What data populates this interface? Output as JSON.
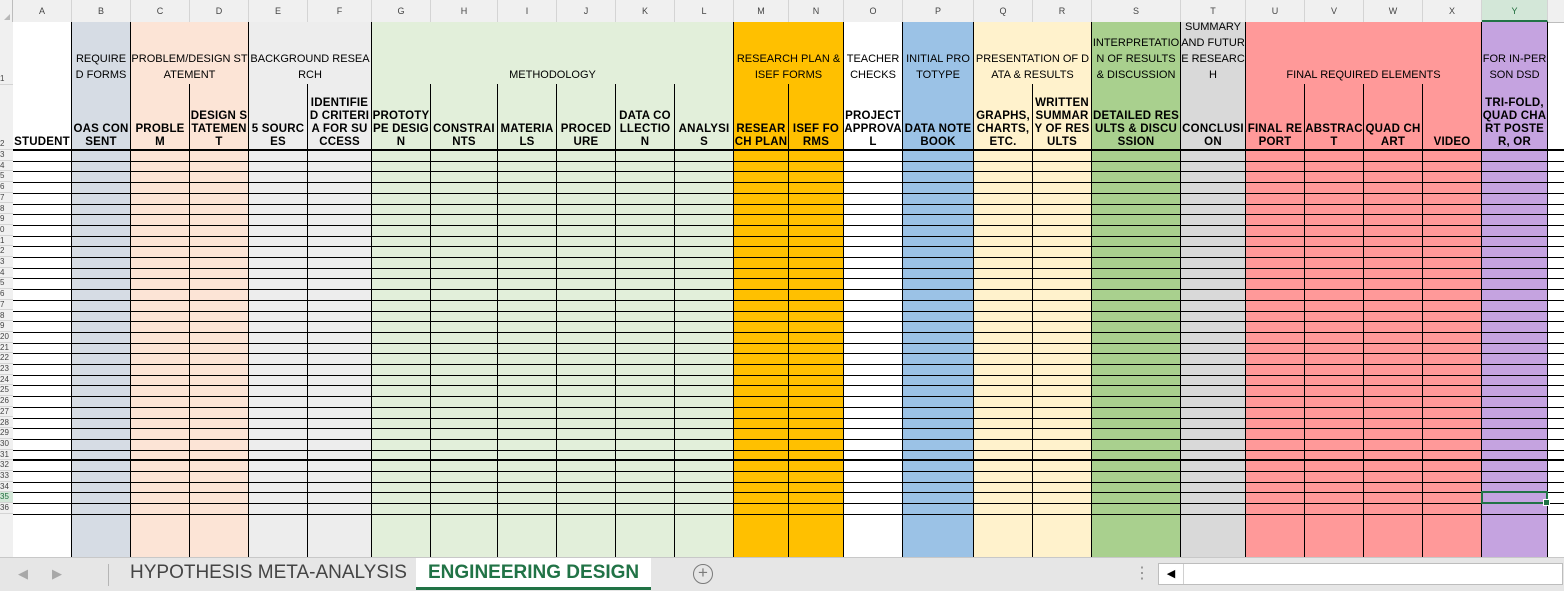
{
  "columns": [
    "A",
    "B",
    "C",
    "D",
    "E",
    "F",
    "G",
    "H",
    "I",
    "J",
    "K",
    "L",
    "M",
    "N",
    "O",
    "P",
    "Q",
    "R",
    "S",
    "T",
    "U",
    "V",
    "W",
    "X",
    "Y"
  ],
  "selected_column": "Y",
  "selected_row": "35",
  "rows": [
    "1",
    "2",
    "3",
    "4",
    "5",
    "6",
    "7",
    "8",
    "9",
    "0",
    "1",
    "2",
    "3",
    "4",
    "5",
    "6",
    "7",
    "8",
    "9",
    "20",
    "21",
    "22",
    "23",
    "24",
    "25",
    "26",
    "27",
    "28",
    "29",
    "30",
    "31",
    "32",
    "33",
    "34",
    "35",
    "36"
  ],
  "groups": [
    {
      "label": "",
      "color": "#ffffff"
    },
    {
      "label": "REQUIRED FORMS",
      "color": "#d6dce4"
    },
    {
      "label": "PROBLEM/DESIGN STATEMENT",
      "color": "#fce4d6"
    },
    {
      "label": "BACKGROUND RESEARCH",
      "color": "#ededed"
    },
    {
      "label": "METHODOLOGY",
      "color": "#e2efda"
    },
    {
      "label": "RESEARCH PLAN & ISEF FORMS",
      "color": "#ffc000"
    },
    {
      "label": "TEACHER CHECKS",
      "color": "#ffffff"
    },
    {
      "label": "INITIAL PROTOTYPE",
      "color": "#9bc2e6"
    },
    {
      "label": "PRESENTATION OF DATA & RESULTS",
      "color": "#fff2cc"
    },
    {
      "label": "INTERPRETATION OF RESULTS & DISCUSSION",
      "color": "#a9d08e"
    },
    {
      "label": "SUMMARY AND FUTURE RESEARCH",
      "color": "#d9d9d9"
    },
    {
      "label": "FINAL REQUIRED ELEMENTS",
      "color": "#ff9999"
    },
    {
      "label": "FOR IN-PERSON DSD",
      "color": "#c5a3e0"
    }
  ],
  "subheaders": [
    "STUDENT",
    "OAS CONSENT",
    "PROBLEM",
    "DESIGN STATEMENT",
    "5 SOURCES",
    "IDENTIFIED CRITERIA FOR SUCCESS",
    "PROTOTYPE DESIGN",
    "CONSTRAINTS",
    "MATERIALS",
    "PROCEDURE",
    "DATA COLLECTION",
    "ANALYSIS",
    "RESEARCH PLAN",
    "ISEF FORMS",
    "PROJECT APPROVAL",
    "DATA NOTEBOOK",
    "GRAPHS, CHARTS, ETC.",
    "WRITTEN SUMMARY OF RESULTS",
    "DETAILED RESULTS & DISCUSSION",
    "CONCLUSION",
    "FINAL REPORT",
    "ABSTRACT",
    "QUAD CHART",
    "VIDEO",
    "TRI-FOLD, QUAD CHART POSTER, OR"
  ],
  "sheet_tabs": [
    {
      "label": "HYPOTHESIS META-ANALYSIS",
      "active": false
    },
    {
      "label": "ENGINEERING DESIGN",
      "active": true
    }
  ],
  "tabbar": {
    "prev_icon": "◀",
    "next_icon": "▶",
    "add_icon": "+",
    "more_icon": "⋮",
    "scroll_left_icon": "◀"
  }
}
